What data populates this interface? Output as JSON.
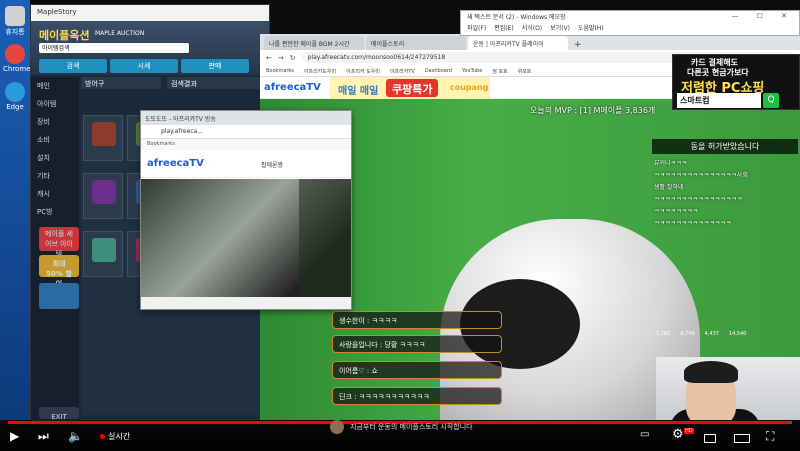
{
  "desktop": {
    "icons": [
      {
        "label": "휴지통",
        "color": "#d0d0d0"
      },
      {
        "label": "Chrome",
        "color": "#e8453c"
      },
      {
        "label": "Edge",
        "color": "#2a9ad8"
      }
    ]
  },
  "maple": {
    "window_title": "MapleStory",
    "brand": "메이플옥션",
    "brand_en": "MAPLE AUCTION",
    "search_label": "아이템검색",
    "tabs": [
      "검색",
      "시세",
      "판매"
    ],
    "dropdown": "방어구",
    "results": "검색결과",
    "sidebar": [
      "메인",
      "아이템",
      "장비",
      "소비",
      "설치",
      "기타",
      "캐시",
      "PC방"
    ],
    "promo1": "메이플 세이브 아이템",
    "promo2": "최대 50% 할인",
    "exit": "EXIT",
    "promo_colors": [
      "#c73737",
      "#c79a30",
      "#2c6aa3"
    ],
    "slot_colors": [
      "#8e3b2e",
      "#4e7a45",
      "#a86a2c",
      "#6b2e8e",
      "#2e5b8e",
      "#8e8a2e",
      "#3e8e7c",
      "#8e2e5b",
      "#5d5d5d"
    ]
  },
  "popup": {
    "title": "도또도또 - 아프리카TV 방송",
    "address": "play.afreeca...",
    "bookmarks": "Bookmarks",
    "logo": "afreecaTV",
    "user": "팝에론짱"
  },
  "dialog": {
    "title": "새 텍스트 문서 (2) - Windows 메모장",
    "menu": [
      "파일(F)",
      "편집(E)",
      "서식(O)",
      "보기(V)",
      "도움말(H)"
    ],
    "controls": "— ☐ ✕"
  },
  "browser": {
    "tabs": [
      "나를 편안한 메이플 BGM 2시간",
      "메이플스토리",
      "운동 | 아프리카TV 플레이어"
    ],
    "active_tab_index": 2,
    "address": "play.afreecatv.com/moonsoo0614/247279518",
    "bookmarks": [
      "Bookmarks",
      "아프리카도우미",
      "아프리카 도우미",
      "아프리카TV",
      "Dashboard",
      "YouTube",
      "정 포토",
      "위포트"
    ],
    "logo": "afreecaTV"
  },
  "banner": {
    "daily": "매일 매일",
    "deal": "쿠팡특가",
    "brand": "coupang"
  },
  "stream": {
    "mvp": "오늘의 MVP : [1] M메이플 3,836개",
    "chat_header": "동을 허가받았습니다",
    "chat_lines": [
      "뷰커니ㅋㅋㅋ",
      "ㅋㅋㅋㅋㅋㅋㅋㅋㅋㅋㅋㅋㅋㅋㅋ사회",
      "생활 잘하네",
      "ㅋㅋㅋㅋㅋㅋㅋㅋㅋㅋㅋㅋㅋㅋㅋㅋ",
      "ㅋㅋㅋㅋㅋㅋㅋㅋ",
      "ㅋㅋㅋㅋㅋㅋㅋㅋㅋㅋㅋㅋㅋㅋ"
    ],
    "stats": [
      "1,160",
      "8,749",
      "4,437",
      "14,540"
    ],
    "bubbles": [
      "생수한이 : ㅋㅋㅋㅋ",
      "사랑을입니다 : 당황 ㅋㅋㅋㅋ",
      "이어름♡ : 쇼",
      "딘크 : ㅋㅋㅋㅋㅋㅋㅋㅋㅋㅋㅋ"
    ]
  },
  "ad": {
    "line1": "카드 결제해도",
    "line2": "다른곳 현금가보다",
    "line3": "저렴한 PC쇼핑",
    "search": "스마트컴",
    "go": "Q"
  },
  "caption": {
    "text": "지금부터 운동의 메이플스토리 시작합니다"
  },
  "player": {
    "live_label": "실시간",
    "progress": 0.995,
    "hd": "HD"
  }
}
